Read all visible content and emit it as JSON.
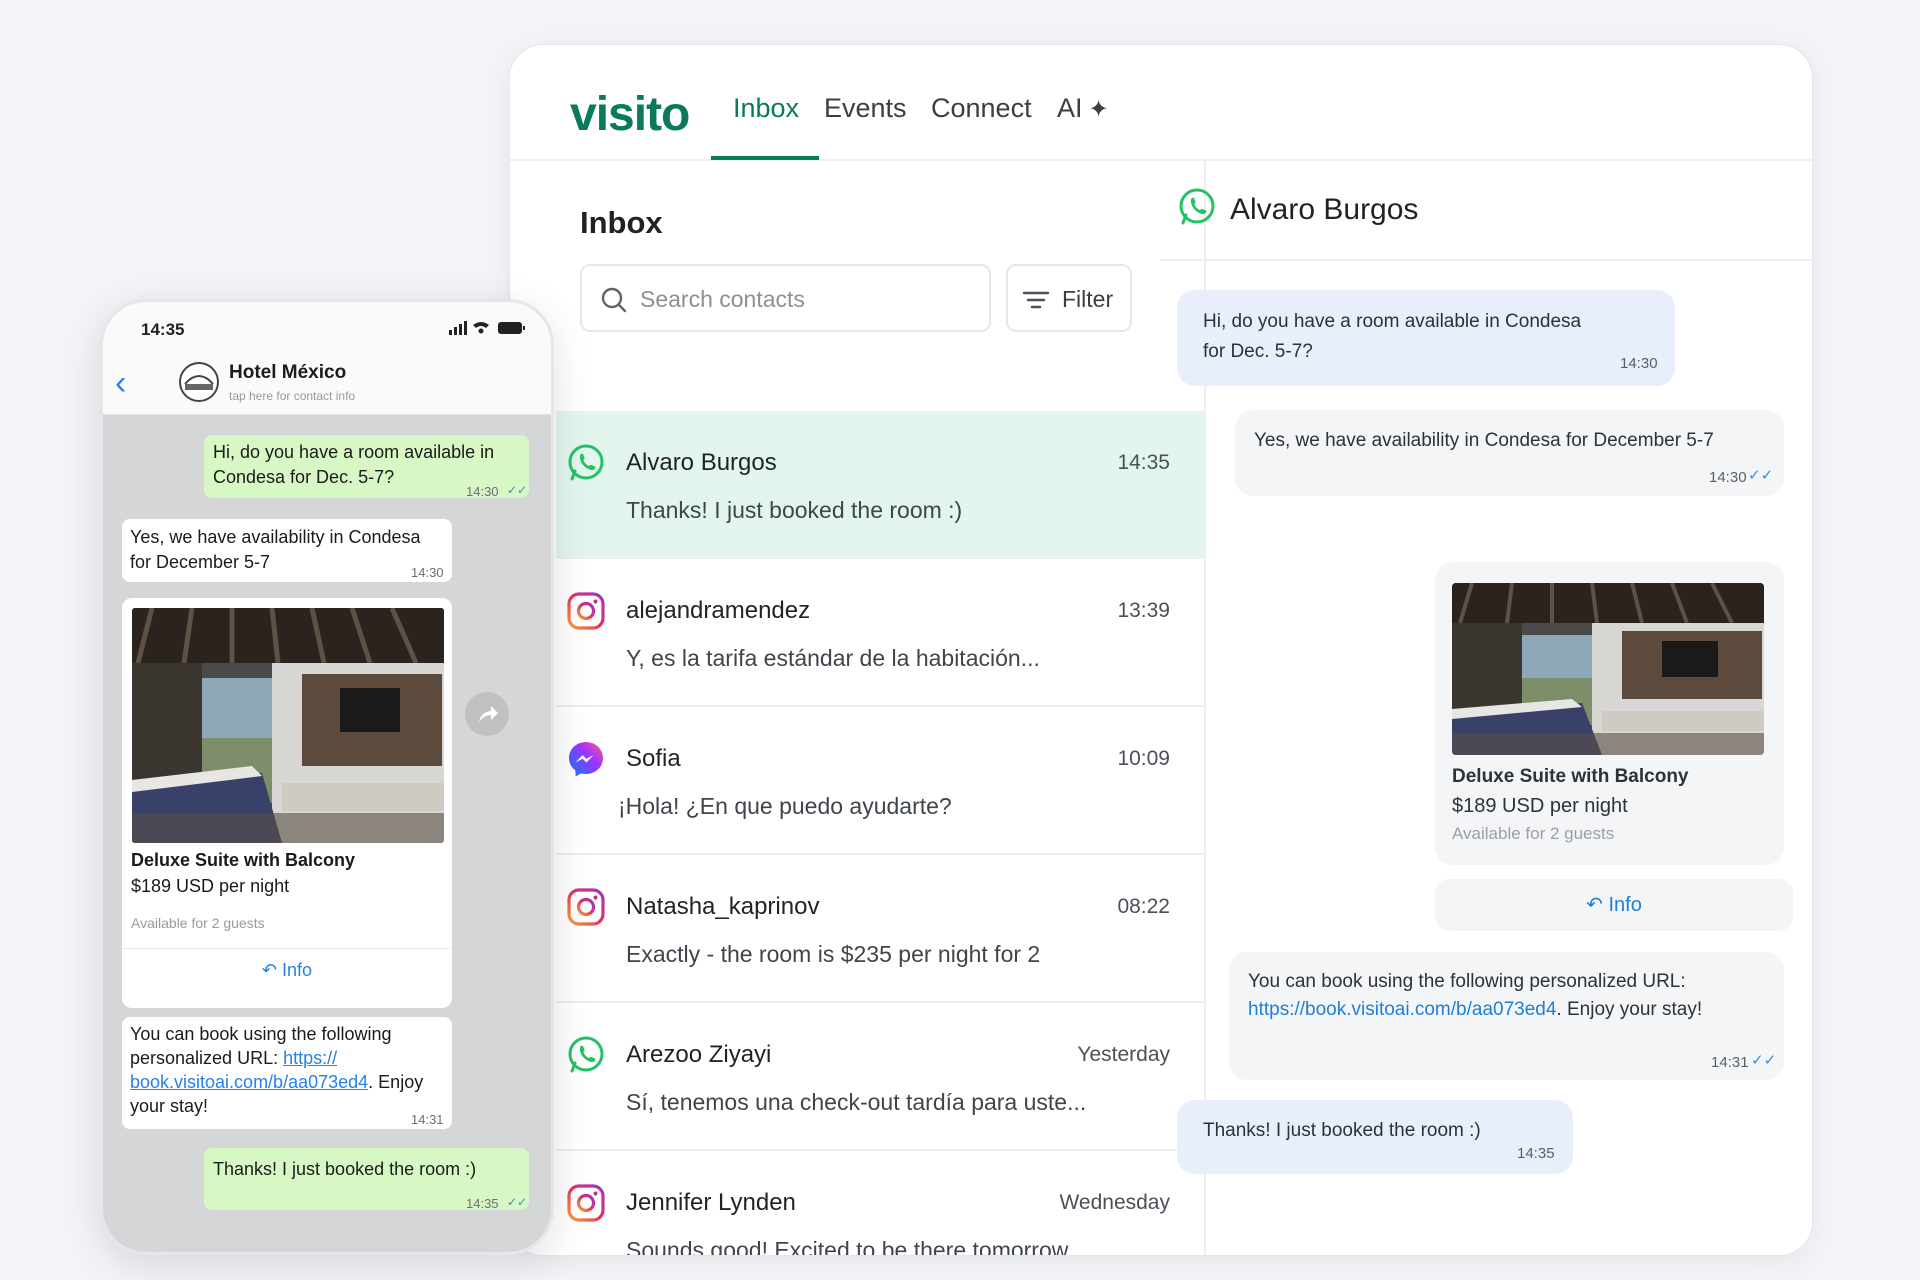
{
  "app": {
    "logo": "visito",
    "nav": [
      {
        "label": "Inbox",
        "active": true
      },
      {
        "label": "Events",
        "active": false
      },
      {
        "label": "Connect",
        "active": false
      },
      {
        "label": "AI",
        "active": false
      }
    ],
    "accent_color": "#0b7a5b"
  },
  "inbox": {
    "title": "Inbox",
    "search_placeholder": "Search contacts",
    "filter_label": "Filter",
    "conversations": [
      {
        "channel": "whatsapp-icon",
        "name": "Alvaro Burgos",
        "time": "14:35",
        "preview": "Thanks! I just booked the room :)",
        "selected": true
      },
      {
        "channel": "instagram-icon",
        "name": "alejandramendez",
        "time": "13:39",
        "preview": "Y, es la tarifa estándar de la habitación...",
        "selected": false
      },
      {
        "channel": "messenger-icon",
        "name": "Sofia",
        "time": "10:09",
        "preview": "¡Hola! ¿En que puedo ayudarte?",
        "selected": false
      },
      {
        "channel": "instagram-icon",
        "name": "Natasha_kaprinov",
        "time": "08:22",
        "preview": "Exactly - the room is $235 per night for 2",
        "selected": false
      },
      {
        "channel": "whatsapp-icon",
        "name": "Arezoo Ziyayi",
        "time": "Yesterday",
        "preview": "Sí, tenemos una check-out tardía para uste...",
        "selected": false
      },
      {
        "channel": "instagram-icon",
        "name": "Jennifer Lynden",
        "time": "Wednesday",
        "preview": "Sounds good! Excited to be there tomorrow...",
        "selected": false
      }
    ]
  },
  "chat": {
    "contact_name": "Alvaro Burgos",
    "messages": {
      "m1_line1": "Hi, do you have a room available in Condesa",
      "m1_line2": "for Dec. 5-7?",
      "m1_time": "14:30",
      "m2_text": "Yes, we have availability in Condesa for December 5-7",
      "m2_time": "14:30",
      "m3_line1": "You can book using the following personalized URL:",
      "m3_link": "https://book.visitoai.com/b/aa073ed4",
      "m3_after": ". Enjoy your stay!",
      "m3_time": "14:31",
      "m4_text": "Thanks! I just booked the room :)",
      "m4_time": "14:35"
    },
    "card": {
      "title": "Deluxe Suite with Balcony",
      "price": "$189 USD per night",
      "availability": "Available for 2 guests",
      "button": "Info"
    }
  },
  "phone": {
    "clock": "14:35",
    "contact_name": "Hotel México",
    "contact_sub": "tap here for contact info",
    "m1_line1": "Hi, do you have a room available in",
    "m1_line2": "Condesa for Dec. 5-7?",
    "m1_time": "14:30",
    "m2_line1": "Yes, we have availability in Condesa",
    "m2_line2": "for December 5-7",
    "m2_time": "14:30",
    "card_title": "Deluxe Suite with Balcony",
    "card_price": "$189 USD per night",
    "card_avail": "Available for 2 guests",
    "card_button": "Info",
    "m3_line1": "You can book using the following",
    "m3_line2a": "personalized URL: ",
    "m3_link1": "https://",
    "m3_link2": "book.visitoai.com/b/aa073ed4",
    "m3_line3b": ". Enjoy",
    "m3_line4": "your stay!",
    "m3_time": "14:31",
    "m4_text": "Thanks! I just booked the room :)",
    "m4_time": "14:35"
  }
}
